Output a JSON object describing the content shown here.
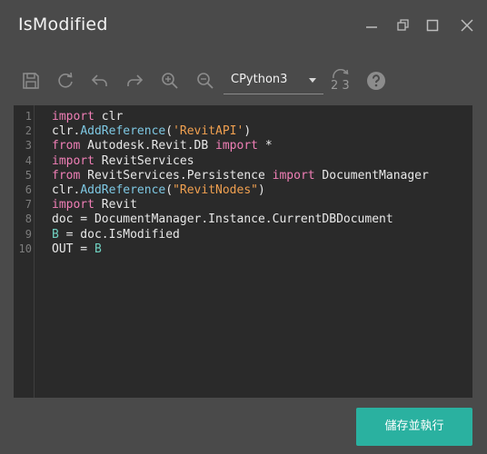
{
  "window": {
    "title": "IsModified",
    "buttons": [
      "minimize-icon",
      "restore-icon",
      "maximize-icon",
      "close-icon"
    ]
  },
  "toolbar": {
    "icons": [
      "save-icon",
      "run-icon",
      "undo-icon",
      "redo-icon",
      "zoom-in-icon",
      "zoom-out-icon"
    ],
    "engine": {
      "selected": "CPython3"
    },
    "migrate_label": "2 3",
    "help_icon": "help-icon"
  },
  "editor": {
    "line_numbers": [
      "1",
      "2",
      "3",
      "4",
      "5",
      "6",
      "7",
      "8",
      "9",
      "10"
    ],
    "lines": [
      [
        {
          "t": "import",
          "c": "kw"
        },
        {
          "t": " clr",
          "c": "plain"
        }
      ],
      [
        {
          "t": "clr.",
          "c": "plain"
        },
        {
          "t": "AddReference",
          "c": "fn"
        },
        {
          "t": "(",
          "c": "plain"
        },
        {
          "t": "'RevitAPI'",
          "c": "str"
        },
        {
          "t": ")",
          "c": "plain"
        }
      ],
      [
        {
          "t": "from",
          "c": "kw"
        },
        {
          "t": " Autodesk.Revit.DB ",
          "c": "plain"
        },
        {
          "t": "import",
          "c": "kw"
        },
        {
          "t": " *",
          "c": "plain"
        }
      ],
      [
        {
          "t": "import",
          "c": "kw"
        },
        {
          "t": " RevitServices",
          "c": "plain"
        }
      ],
      [
        {
          "t": "from",
          "c": "kw"
        },
        {
          "t": " RevitServices.Persistence ",
          "c": "plain"
        },
        {
          "t": "import",
          "c": "kw"
        },
        {
          "t": " DocumentManager",
          "c": "plain"
        }
      ],
      [
        {
          "t": "clr.",
          "c": "plain"
        },
        {
          "t": "AddReference",
          "c": "fn"
        },
        {
          "t": "(",
          "c": "plain"
        },
        {
          "t": "\"RevitNodes\"",
          "c": "str"
        },
        {
          "t": ")",
          "c": "plain"
        }
      ],
      [
        {
          "t": "import",
          "c": "kw"
        },
        {
          "t": " Revit",
          "c": "plain"
        }
      ],
      [
        {
          "t": "doc = DocumentManager.Instance.CurrentDBDocument",
          "c": "plain"
        }
      ],
      [
        {
          "t": "B",
          "c": "var"
        },
        {
          "t": " = doc.IsModified",
          "c": "plain"
        }
      ],
      [
        {
          "t": "OUT = ",
          "c": "plain"
        },
        {
          "t": "B",
          "c": "var"
        }
      ]
    ]
  },
  "footer": {
    "run_label": "儲存並執行"
  },
  "colors": {
    "accent": "#2ab1a0",
    "keyword": "#f07fb6",
    "function": "#7ec8e3",
    "string": "#f0a050",
    "variable": "#6fd0c0"
  }
}
